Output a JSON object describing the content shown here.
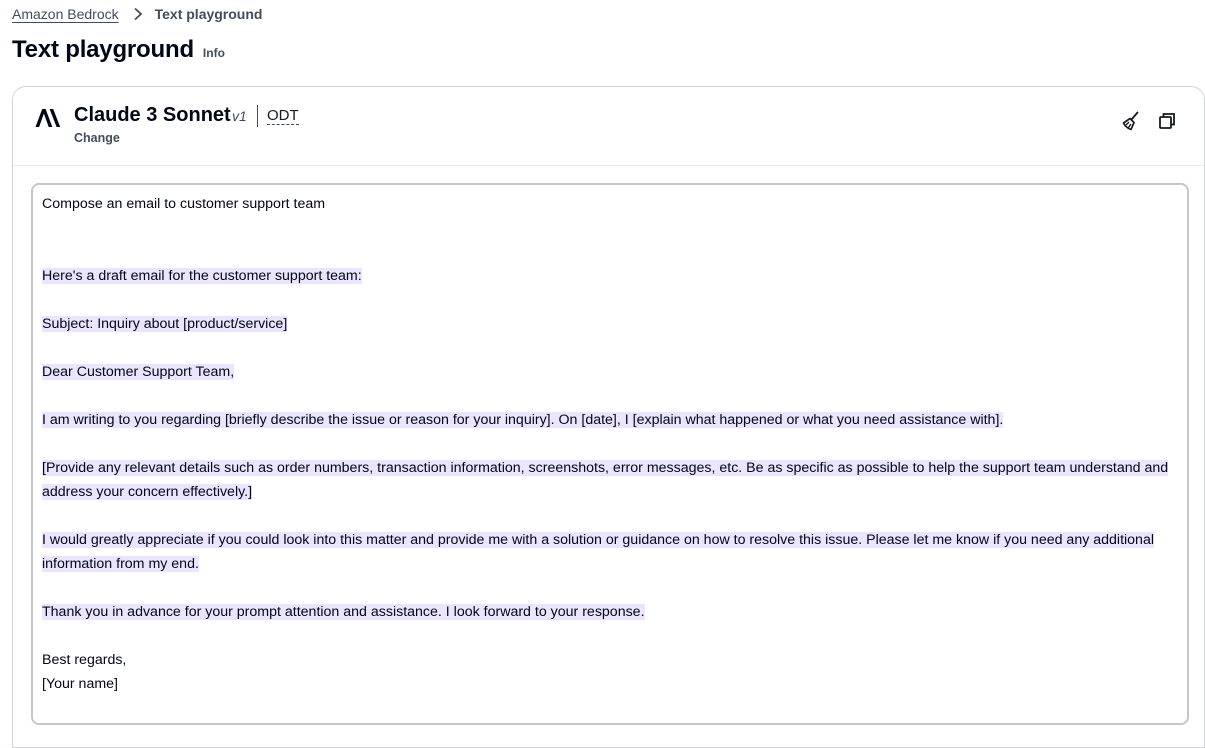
{
  "breadcrumb": {
    "root": "Amazon Bedrock",
    "current": "Text playground"
  },
  "page": {
    "title": "Text playground",
    "info": "Info"
  },
  "model": {
    "name": "Claude 3 Sonnet",
    "version": "v1",
    "throughput": "ODT",
    "change": "Change"
  },
  "icons": {
    "logo": "anthropic-logo-icon",
    "clear": "broom-icon",
    "copy": "copy-icon"
  },
  "conversation": {
    "prompt": "Compose an email to customer support team",
    "response": [
      "Here's a draft email for the customer support team:",
      "Subject: Inquiry about [product/service]",
      "Dear Customer Support Team,",
      "I am writing to you regarding [briefly describe the issue or reason for your inquiry]. On [date], I [explain what happened or what you need assistance with].",
      "[Provide any relevant details such as order numbers, transaction information, screenshots, error messages, etc. Be as specific as possible to help the support team understand and address your concern effectively.]",
      "I would greatly appreciate if you could look into this matter and provide me with a solution or guidance on how to resolve this issue. Please let me know if you need any additional information from my end.",
      "Thank you in advance for your prompt attention and assistance. I look forward to your response.",
      "Best regards,",
      "[Your name]"
    ]
  },
  "colors": {
    "highlight": "#ece4ff",
    "text": "#000716",
    "muted": "#414d5c"
  }
}
